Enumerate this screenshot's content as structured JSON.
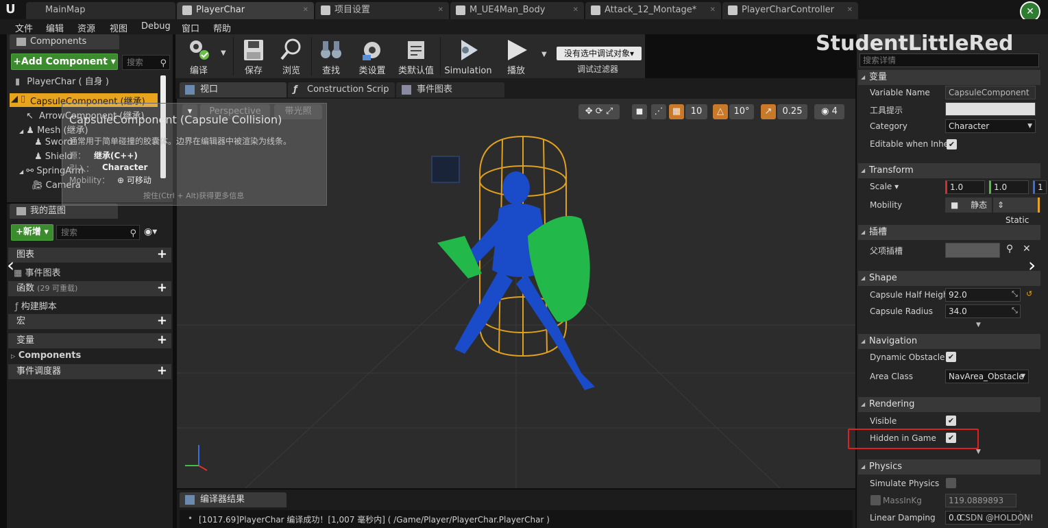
{
  "tabs": [
    {
      "label": "MainMap"
    },
    {
      "label": "PlayerChar"
    },
    {
      "label": "项目设置"
    },
    {
      "label": "M_UE4Man_Body"
    },
    {
      "label": "Attack_12_Montage*"
    },
    {
      "label": "PlayerCharController"
    }
  ],
  "menu": [
    "文件",
    "编辑",
    "资源",
    "视图",
    "Debug",
    "窗口",
    "帮助"
  ],
  "watermark": "StudentLittleRed",
  "components": {
    "tab": "Components",
    "add_button": "+Add Component ▾",
    "search_placeholder": "搜索",
    "root": "PlayerChar ( 自身 )",
    "items": [
      "CapsuleComponent (继承)",
      "ArrowComponent (继承)",
      "Mesh (继承)",
      "Sword",
      "Shield",
      "SpringArm",
      "Camera"
    ]
  },
  "tooltip": {
    "title": "CapsuleComponent (Capsule Collision)",
    "desc": "通常用于简单碰撞的胶囊体。边界在编辑器中被渲染为线条。",
    "source_label": "源：",
    "source_value": "继承(C++)",
    "intro_label": "引入：",
    "intro_value": "Character",
    "mobility_label": "Mobility：",
    "mobility_value": "可移动",
    "hint": "按住(Ctrl + Alt)获得更多信息"
  },
  "myblueprint": {
    "tab": "我的蓝图",
    "new_button": "+新增 ▾",
    "search_placeholder": "搜索",
    "sections": {
      "graphs": "图表",
      "event_graph": "事件图表",
      "functions": "函数",
      "functions_count": "(29 可重载)",
      "construct_script": "构建脚本",
      "macros": "宏",
      "variables": "变量",
      "components": "Components",
      "dispatchers": "事件调度器"
    }
  },
  "toolbar": {
    "buttons": [
      "编译",
      "保存",
      "浏览",
      "查找",
      "类设置",
      "类默认值",
      "Simulation",
      "播放"
    ],
    "debug_select": "没有选中调试对象▾",
    "debug_filter": "调试过滤器"
  },
  "editor_tabs": [
    "视口",
    "Construction Scrip",
    "事件图表"
  ],
  "viewport": {
    "perspective": "Perspective",
    "lit": "带光照",
    "grid_snap": "10",
    "rot_snap": "10°",
    "scale_snap": "0.25",
    "cam_speed": "4"
  },
  "details": {
    "search_placeholder": "搜索详情",
    "variable": {
      "header": "变量",
      "name_label": "Variable Name",
      "name_value": "CapsuleComponent",
      "tooltip_label": "工具提示",
      "category_label": "Category",
      "category_value": "Character",
      "editable_label": "Editable when Inher"
    },
    "transform": {
      "header": "Transform",
      "scale_label": "Scale ▾",
      "scale_x": "1.0",
      "scale_y": "1.0",
      "scale_z": "1",
      "mobility_label": "Mobility",
      "mobility_static": "静态",
      "mobility_static2": "Static"
    },
    "socket": {
      "header": "插槽",
      "parent_label": "父项插槽"
    },
    "shape": {
      "header": "Shape",
      "half_height_label": "Capsule Half Heigh",
      "half_height_value": "92.0",
      "radius_label": "Capsule Radius",
      "radius_value": "34.0"
    },
    "navigation": {
      "header": "Navigation",
      "dynamic_label": "Dynamic Obstacle",
      "area_label": "Area Class",
      "area_value": "NavArea_Obstacle"
    },
    "rendering": {
      "header": "Rendering",
      "visible_label": "Visible",
      "hidden_label": "Hidden in Game"
    },
    "physics": {
      "header": "Physics",
      "simulate_label": "Simulate Physics",
      "mass_label": "MassInKg",
      "mass_value": "119.0889893",
      "damping_label": "Linear Damping",
      "damping_value": "0.0"
    }
  },
  "compiler": {
    "tab": "编译器结果",
    "message": "[1017.69]PlayerChar 编译成功！[1,007 毫秒内] ( /Game/Player/PlayerChar.PlayerChar )"
  },
  "csdn": "CSDN @HOLDON!",
  "colors": {
    "selection": "#e8a41c",
    "highlight_box": "#e02020",
    "add_green": "#3d8b2f",
    "capsule": "#e0a020",
    "mesh_blue": "#1a4bc8",
    "shield_green": "#22b84a"
  }
}
